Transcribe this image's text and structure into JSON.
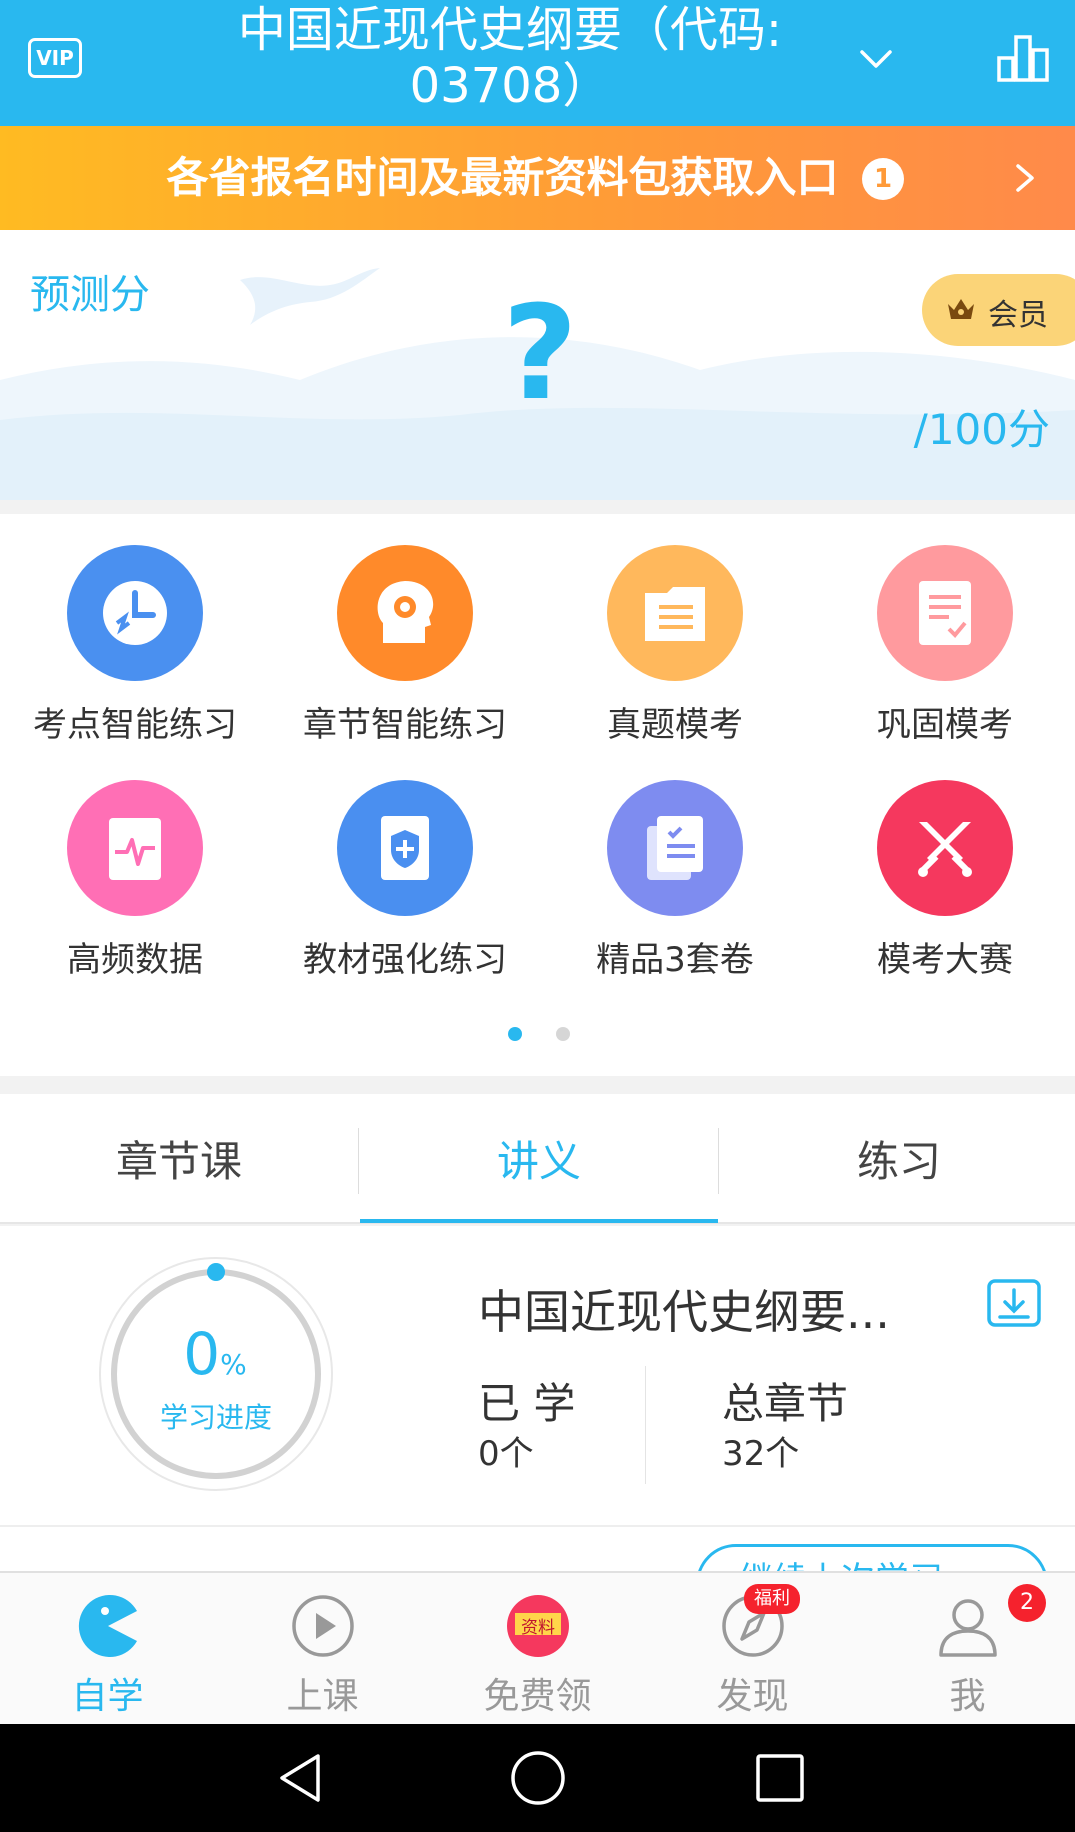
{
  "header": {
    "vip_label": "VIP",
    "title_line1": "中国近现代史纲要（代码:",
    "title_line2": "03708）"
  },
  "banner": {
    "text": "各省报名时间及最新资料包获取入口",
    "badge_count": "1"
  },
  "predict": {
    "label": "预测分",
    "score": "?",
    "max": "/100分",
    "member_label": "会员"
  },
  "grid": {
    "items": [
      {
        "label": "考点智能练习",
        "icon": "clock-icon",
        "color": "#4a90f0"
      },
      {
        "label": "章节智能练习",
        "icon": "head-gear-icon",
        "color": "#ff8a2a"
      },
      {
        "label": "真题模考",
        "icon": "folder-icon",
        "color": "#ffb85c"
      },
      {
        "label": "巩固模考",
        "icon": "checklist-icon",
        "color": "#ff9a9e"
      },
      {
        "label": "高频数据",
        "icon": "pulse-chart-icon",
        "color": "#ff6fb5"
      },
      {
        "label": "教材强化练习",
        "icon": "shield-book-icon",
        "color": "#4a8ff0"
      },
      {
        "label": "精品3套卷",
        "icon": "papers-icon",
        "color": "#7e8cf0"
      },
      {
        "label": "模考大赛",
        "icon": "crossed-swords-icon",
        "color": "#f5385e"
      }
    ],
    "page_dots": {
      "count": 2,
      "active": 0
    }
  },
  "tabs": {
    "items": [
      "章节课",
      "讲义",
      "练习"
    ],
    "active": 1
  },
  "progress": {
    "percent": "0",
    "percent_sign": "%",
    "label": "学习进度",
    "doc_title": "中国近现代史纲要...",
    "learned_label": "已 学",
    "learned_value": "0个",
    "total_label": "总章节",
    "total_value": "32个",
    "continue_label": "继续上次学习"
  },
  "bottom_nav": {
    "items": [
      {
        "label": "自学",
        "icon": "pacman-icon"
      },
      {
        "label": "上课",
        "icon": "play-circle-icon"
      },
      {
        "label": "免费领",
        "icon": "gift-ziliao-icon",
        "tag": "资料"
      },
      {
        "label": "发现",
        "icon": "compass-icon",
        "tag": "福利"
      },
      {
        "label": "我",
        "icon": "user-icon",
        "badge": "2"
      }
    ],
    "active": 0
  },
  "colors": {
    "primary": "#29b8ef",
    "banner_start": "#ffbb22",
    "banner_end": "#ff8a4a",
    "badge_red": "#f5222d"
  }
}
